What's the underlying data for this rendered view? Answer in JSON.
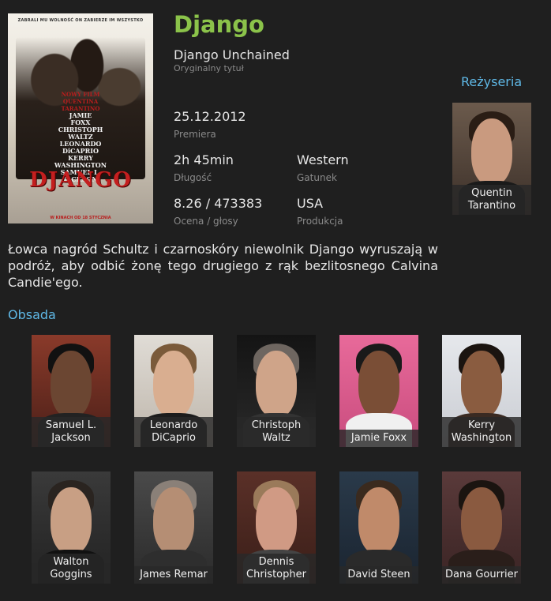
{
  "poster": {
    "tagline": "ZABRALI MU WOLNOŚĆ ON ZABIERZE IM WSZYSTKO",
    "credits": [
      "NOWY FILM",
      "QUENTINA",
      "TARANTINO",
      "JAMIE",
      "FOXX",
      "CHRISTOPH",
      "WALTZ",
      "LEONARDO",
      "DiCAPRIO",
      "KERRY",
      "WASHINGTON",
      "SAMUEL L.",
      "JACKSON"
    ],
    "logo": "DJANGO",
    "bottom": "W KINACH OD 18 STYCZNIA"
  },
  "movie": {
    "title": "Django",
    "original_title": "Django Unchained",
    "original_title_label": "Oryginalny tytuł",
    "premiere": "25.12.2012",
    "premiere_label": "Premiera",
    "duration": "2h 45min",
    "duration_label": "Długość",
    "genre": "Western",
    "genre_label": "Gatunek",
    "rating": "8.26 / 473383",
    "rating_label": "Ocena / głosy",
    "production": "USA",
    "production_label": "Produkcja",
    "description": "Łowca nagród Schultz i czarnoskóry niewolnik Django wyruszają w podróż, aby odbić żonę tego drugiego z rąk bezlitosnego Calvina Candie'ego."
  },
  "director": {
    "heading": "Reżyseria",
    "name": "Quentin Tarantino"
  },
  "cast": {
    "heading": "Obsada",
    "members": [
      {
        "name": "Samuel L. Jackson"
      },
      {
        "name": "Leonardo DiCaprio"
      },
      {
        "name": "Christoph Waltz"
      },
      {
        "name": "Jamie Foxx"
      },
      {
        "name": "Kerry Washington"
      },
      {
        "name": "Walton Goggins"
      },
      {
        "name": "James Remar"
      },
      {
        "name": "Dennis Christopher"
      },
      {
        "name": "David Steen"
      },
      {
        "name": "Dana Gourrier"
      }
    ]
  },
  "colors": {
    "title": "#8bc34a",
    "heading": "#5fb8e6",
    "background": "#1f1f1f"
  }
}
